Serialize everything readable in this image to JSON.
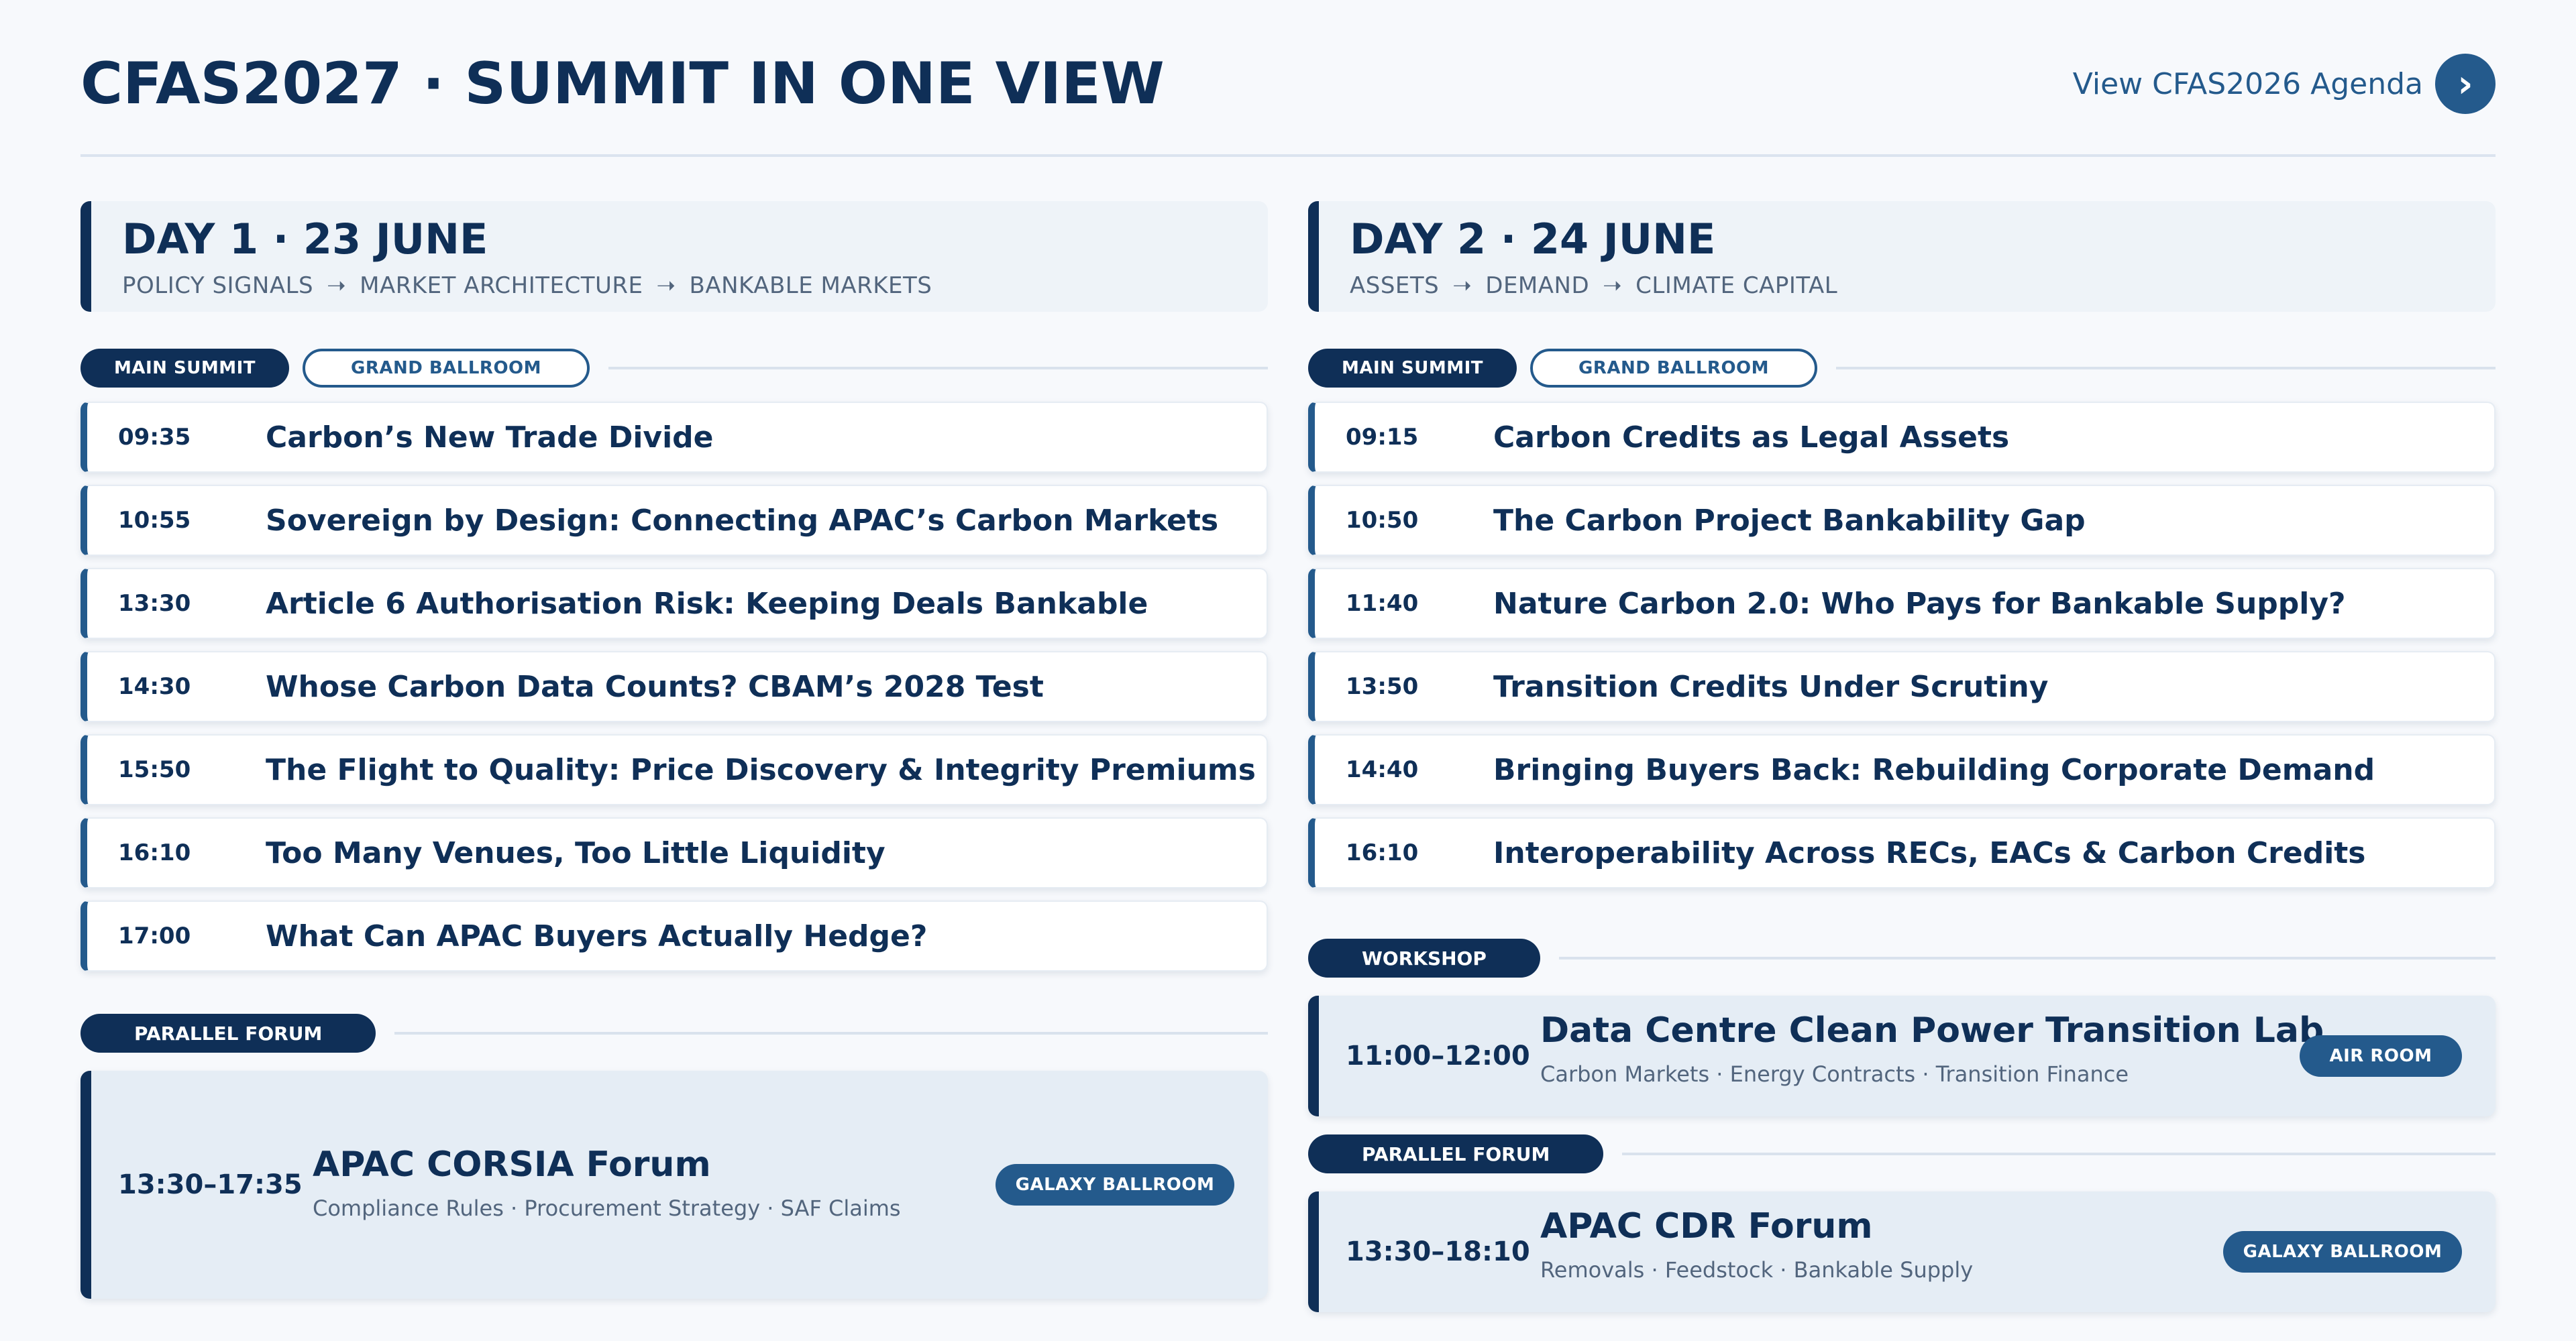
{
  "page": {
    "title": "CFAS2027 · SUMMIT IN ONE VIEW",
    "agenda_link": "View CFAS2026 Agenda",
    "colors": {
      "navy": "#0f2f57",
      "blue": "#245a8c",
      "muted": "#52657d",
      "card_bg": "#eef3f8"
    }
  },
  "day1": {
    "title": "DAY 1 · 23 JUNE",
    "subtitle": [
      "POLICY SIGNALS",
      "MARKET ARCHITECTURE",
      "BANKABLE MARKETS"
    ],
    "pill_main": "MAIN SUMMIT",
    "pill_room": "GRAND BALLROOM",
    "sessions": [
      {
        "time": "09:35",
        "title": "Carbon’s New Trade Divide"
      },
      {
        "time": "10:55",
        "title": "Sovereign by Design: Connecting APAC’s Carbon Markets"
      },
      {
        "time": "13:30",
        "title": "Article 6 Authorisation Risk: Keeping Deals Bankable"
      },
      {
        "time": "14:30",
        "title": "Whose Carbon Data Counts? CBAM’s 2028 Test"
      },
      {
        "time": "15:50",
        "title": "The Flight to Quality: Price Discovery & Integrity Premiums"
      },
      {
        "time": "16:10",
        "title": "Too Many Venues, Too Little Liquidity"
      },
      {
        "time": "17:00",
        "title": "What Can APAC Buyers Actually Hedge?"
      }
    ],
    "forum_label": "PARALLEL FORUM",
    "forum": {
      "time": "13:30–17:35",
      "title": "APAC CORSIA Forum",
      "tags": "Compliance Rules · Procurement Strategy · SAF Claims",
      "room": "GALAXY BALLROOM"
    }
  },
  "day2": {
    "title": "DAY 2 · 24 JUNE",
    "subtitle": [
      "ASSETS",
      "DEMAND",
      "CLIMATE CAPITAL"
    ],
    "pill_main": "MAIN SUMMIT",
    "pill_room": "GRAND BALLROOM",
    "sessions": [
      {
        "time": "09:15",
        "title": "Carbon Credits as Legal Assets"
      },
      {
        "time": "10:50",
        "title": "The Carbon Project Bankability Gap"
      },
      {
        "time": "11:40",
        "title": "Nature Carbon 2.0: Who Pays for Bankable Supply?"
      },
      {
        "time": "13:50",
        "title": "Transition Credits Under Scrutiny"
      },
      {
        "time": "14:40",
        "title": "Bringing Buyers Back: Rebuilding Corporate Demand"
      },
      {
        "time": "16:10",
        "title": "Interoperability Across RECs, EACs & Carbon Credits"
      }
    ],
    "workshop_label": "WORKSHOP",
    "workshop": {
      "time": "11:00–12:00",
      "title": "Data Centre Clean Power Transition Lab",
      "tags": "Carbon Markets · Energy Contracts · Transition Finance",
      "room": "AIR ROOM"
    },
    "forum_label": "PARALLEL FORUM",
    "forum": {
      "time": "13:30–18:10",
      "title": "APAC CDR Forum",
      "tags": "Removals · Feedstock · Bankable Supply",
      "room": "GALAXY BALLROOM"
    }
  }
}
